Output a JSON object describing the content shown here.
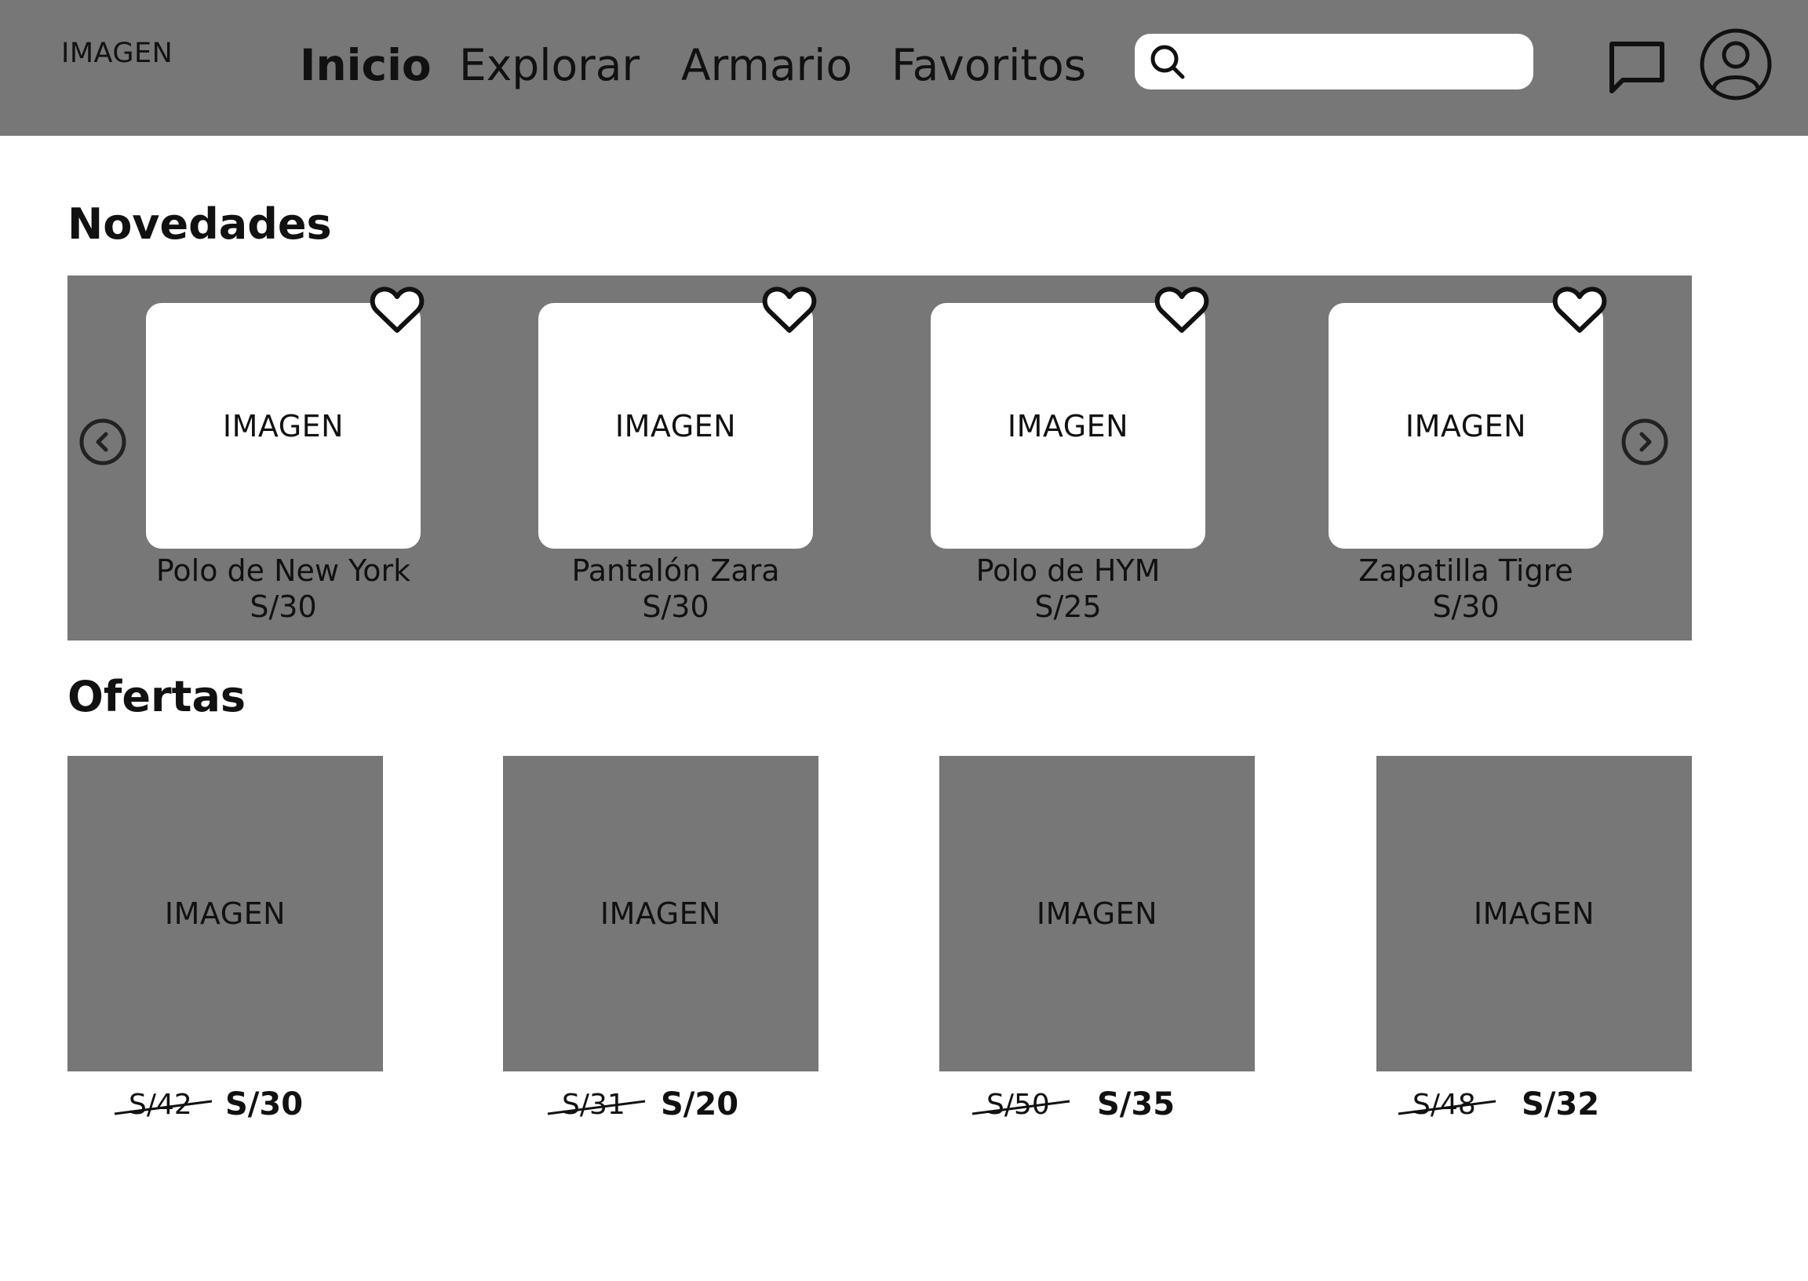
{
  "header": {
    "logo": "IMAGEN",
    "nav": [
      "Inicio",
      "Explorar",
      "Armario",
      "Favoritos"
    ],
    "active_nav": "Inicio",
    "search": {
      "value": "",
      "placeholder": ""
    },
    "icons": {
      "search": "search-icon",
      "chat": "chat-icon",
      "profile": "user-avatar-icon"
    }
  },
  "novedades": {
    "title": "Novedades",
    "prev_icon": "chevron-left-circle-icon",
    "next_icon": "chevron-right-circle-icon",
    "items": [
      {
        "image": "IMAGEN",
        "name": "Polo de New York",
        "price": "S/30",
        "icon": "heart-icon"
      },
      {
        "image": "IMAGEN",
        "name": "Pantalón Zara",
        "price": "S/30",
        "icon": "heart-icon"
      },
      {
        "image": "IMAGEN",
        "name": "Polo de HYM",
        "price": "S/25",
        "icon": "heart-icon"
      },
      {
        "image": "IMAGEN",
        "name": "Zapatilla Tigre",
        "price": "S/30",
        "icon": "heart-icon"
      }
    ]
  },
  "ofertas": {
    "title": "Ofertas",
    "items": [
      {
        "image": "IMAGEN",
        "old_price": "S/42",
        "new_price": "S/30"
      },
      {
        "image": "IMAGEN",
        "old_price": "S/31",
        "new_price": "S/20"
      },
      {
        "image": "IMAGEN",
        "old_price": "S/50",
        "new_price": "S/35"
      },
      {
        "image": "IMAGEN",
        "old_price": "S/48",
        "new_price": "S/32"
      }
    ]
  },
  "colors": {
    "panel_gray": "#777777",
    "background": "#ffffff",
    "text": "#111111"
  }
}
